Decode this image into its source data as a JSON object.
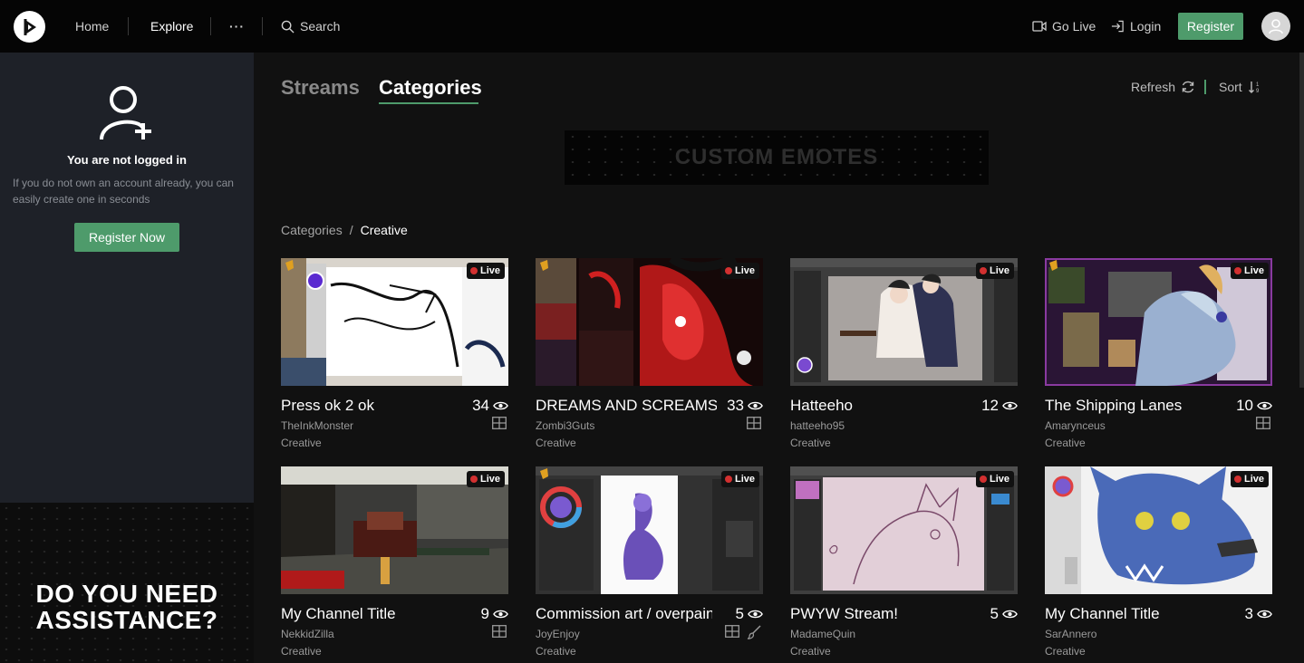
{
  "nav": {
    "home": "Home",
    "explore": "Explore",
    "more": "···",
    "search": "Search",
    "go_live": "Go Live",
    "login": "Login",
    "register": "Register"
  },
  "sidebar": {
    "title": "You are not logged in",
    "description": "If you do not own an account already, you can easily create one in seconds",
    "register_button": "Register Now",
    "banner_text": "DO YOU NEED ASSISTANCE?"
  },
  "main": {
    "tabs": [
      {
        "label": "Streams",
        "active": false
      },
      {
        "label": "Categories",
        "active": true
      }
    ],
    "refresh_label": "Refresh",
    "sort_label": "Sort",
    "banner_text": "CUSTOM EMOTES",
    "breadcrumb": {
      "root": "Categories",
      "separator": "/",
      "current": "Creative"
    }
  },
  "live_label": "Live",
  "colors": {
    "accent": "#4e9b6b",
    "live_dot": "#d23030"
  },
  "cards": [
    {
      "title": "Press ok 2 ok",
      "viewers": "34",
      "user": "TheInkMonster",
      "category": "Creative",
      "icons": [
        "grid-icon"
      ]
    },
    {
      "title": "DREAMS AND SCREAMS",
      "viewers": "33",
      "user": "Zombi3Guts",
      "category": "Creative",
      "icons": [
        "grid-icon"
      ]
    },
    {
      "title": "Hatteeho",
      "viewers": "12",
      "user": "hatteeho95",
      "category": "Creative",
      "icons": []
    },
    {
      "title": "The Shipping Lanes",
      "viewers": "10",
      "user": "Amarynceus",
      "category": "Creative",
      "icons": [
        "grid-icon"
      ]
    },
    {
      "title": "My Channel Title",
      "viewers": "9",
      "user": "NekkidZilla",
      "category": "Creative",
      "icons": [
        "grid-icon"
      ]
    },
    {
      "title": "Commission art / overpaint",
      "viewers": "5",
      "user": "JoyEnjoy",
      "category": "Creative",
      "icons": [
        "grid-icon",
        "brush-icon"
      ]
    },
    {
      "title": "PWYW Stream!",
      "viewers": "5",
      "user": "MadameQuin",
      "category": "Creative",
      "icons": []
    },
    {
      "title": "My Channel Title",
      "viewers": "3",
      "user": "SarAnnero",
      "category": "Creative",
      "icons": []
    }
  ]
}
